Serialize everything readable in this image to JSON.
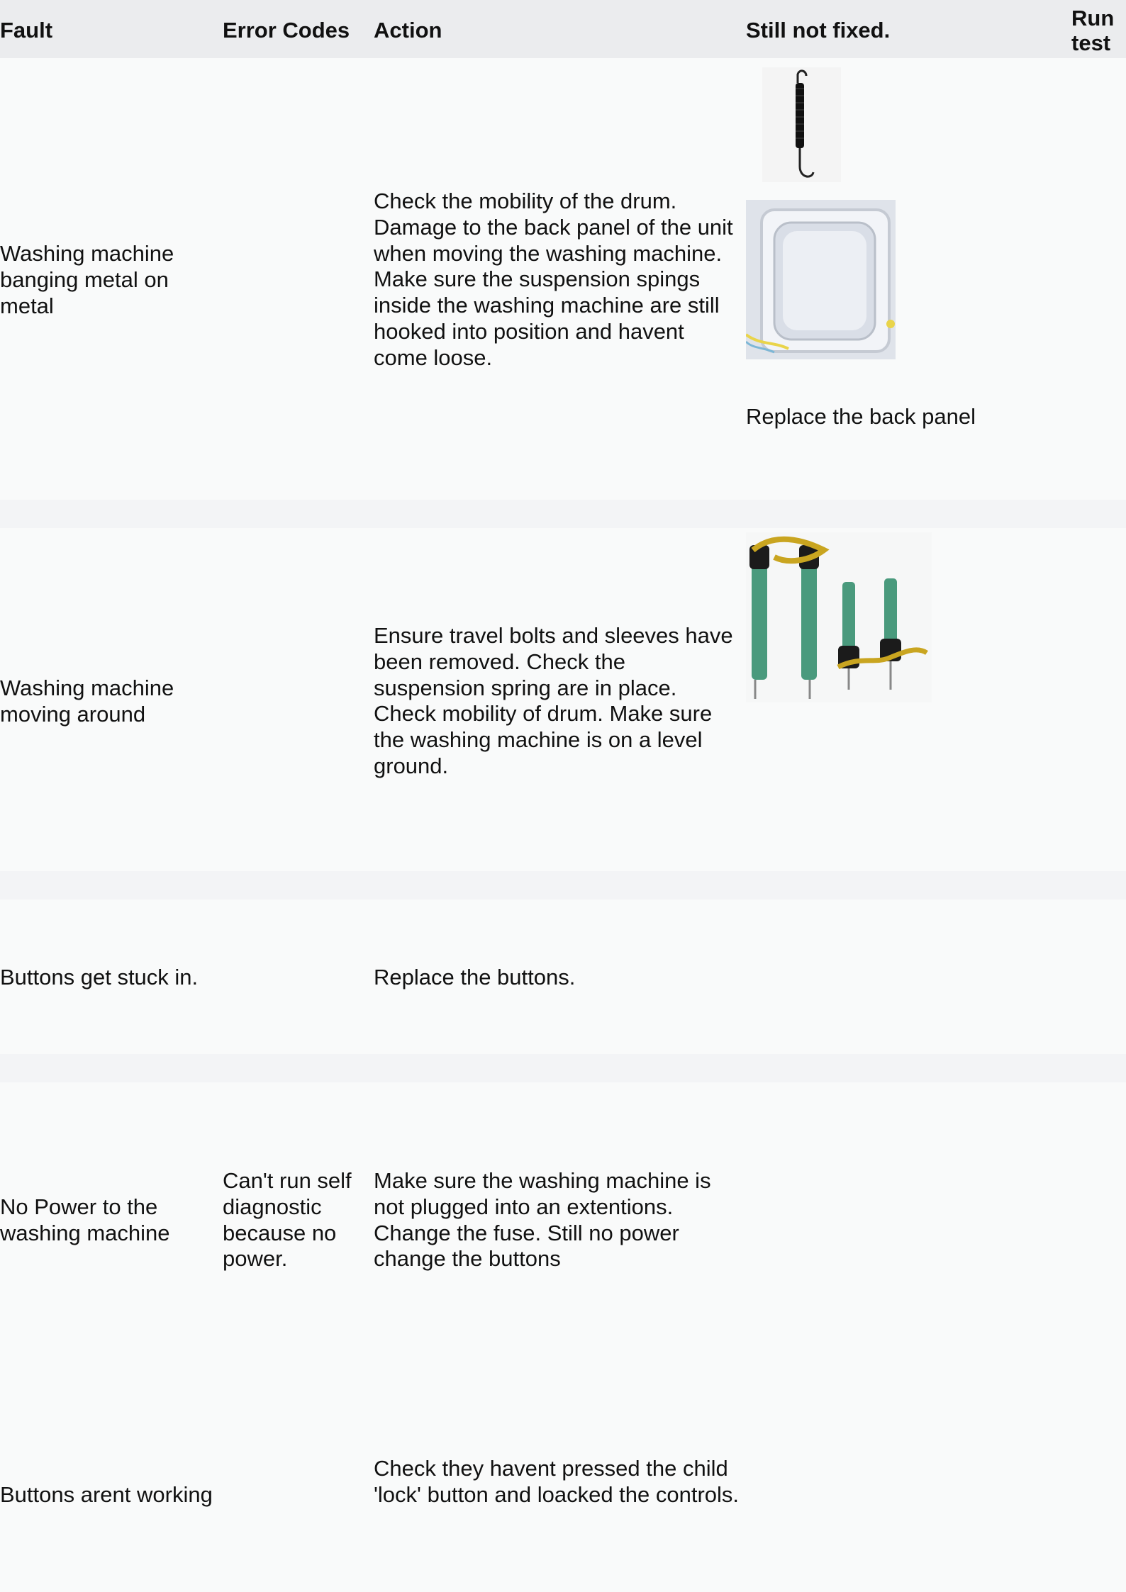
{
  "table": {
    "headers": {
      "fault": "Fault",
      "error_codes": "Error Codes",
      "action": "Action",
      "still_not_fixed": "Still not fixed.",
      "run_test": "Run test"
    },
    "rows": [
      {
        "fault": "Washing machine banging metal on metal",
        "error_codes": "",
        "action": "Check the mobility of the drum. Damage to the back panel of the unit when moving the washing machine. Make sure the suspension spings inside the washing machine are still hooked into position and havent come loose.",
        "still_not_fixed": "Replace the back panel",
        "images": [
          "suspension-spring-image",
          "back-panel-image"
        ]
      },
      {
        "fault": "Washing machine moving around",
        "error_codes": "",
        "action": "Ensure travel bolts and sleeves have been removed. Check the suspension spring are in place. Check mobility of drum. Make sure the washing machine is on a level ground.",
        "still_not_fixed": "",
        "images": [
          "travel-bolts-image"
        ]
      },
      {
        "fault": "Buttons get stuck in.",
        "error_codes": "",
        "action": "Replace the buttons.",
        "still_not_fixed": ""
      },
      {
        "fault": "No Power to the washing machine",
        "error_codes": "Can't run self diagnostic because no power.",
        "action": "Make sure the washing machine is not plugged into an extentions. Change the fuse. Still no power change the buttons",
        "still_not_fixed": ""
      },
      {
        "fault": "Buttons arent working",
        "error_codes": "",
        "action": "Check they havent pressed the child 'lock' button and loacked the controls.",
        "still_not_fixed": ""
      }
    ]
  }
}
